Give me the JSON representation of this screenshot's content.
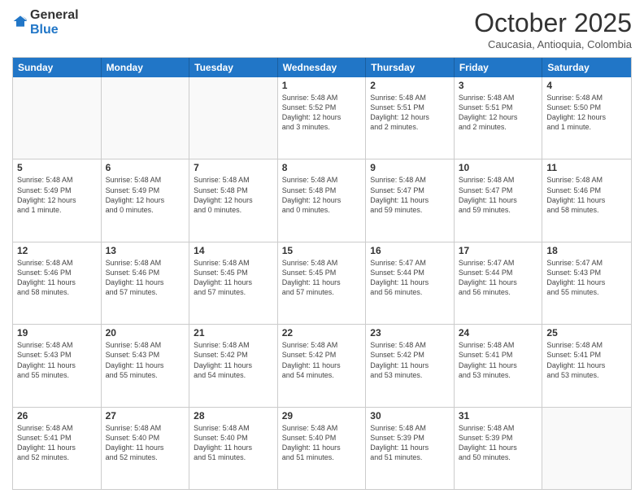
{
  "header": {
    "logo_general": "General",
    "logo_blue": "Blue",
    "month_title": "October 2025",
    "location": "Caucasia, Antioquia, Colombia"
  },
  "day_headers": [
    "Sunday",
    "Monday",
    "Tuesday",
    "Wednesday",
    "Thursday",
    "Friday",
    "Saturday"
  ],
  "rows": [
    [
      {
        "date": "",
        "info": ""
      },
      {
        "date": "",
        "info": ""
      },
      {
        "date": "",
        "info": ""
      },
      {
        "date": "1",
        "info": "Sunrise: 5:48 AM\nSunset: 5:52 PM\nDaylight: 12 hours\nand 3 minutes."
      },
      {
        "date": "2",
        "info": "Sunrise: 5:48 AM\nSunset: 5:51 PM\nDaylight: 12 hours\nand 2 minutes."
      },
      {
        "date": "3",
        "info": "Sunrise: 5:48 AM\nSunset: 5:51 PM\nDaylight: 12 hours\nand 2 minutes."
      },
      {
        "date": "4",
        "info": "Sunrise: 5:48 AM\nSunset: 5:50 PM\nDaylight: 12 hours\nand 1 minute."
      }
    ],
    [
      {
        "date": "5",
        "info": "Sunrise: 5:48 AM\nSunset: 5:49 PM\nDaylight: 12 hours\nand 1 minute."
      },
      {
        "date": "6",
        "info": "Sunrise: 5:48 AM\nSunset: 5:49 PM\nDaylight: 12 hours\nand 0 minutes."
      },
      {
        "date": "7",
        "info": "Sunrise: 5:48 AM\nSunset: 5:48 PM\nDaylight: 12 hours\nand 0 minutes."
      },
      {
        "date": "8",
        "info": "Sunrise: 5:48 AM\nSunset: 5:48 PM\nDaylight: 12 hours\nand 0 minutes."
      },
      {
        "date": "9",
        "info": "Sunrise: 5:48 AM\nSunset: 5:47 PM\nDaylight: 11 hours\nand 59 minutes."
      },
      {
        "date": "10",
        "info": "Sunrise: 5:48 AM\nSunset: 5:47 PM\nDaylight: 11 hours\nand 59 minutes."
      },
      {
        "date": "11",
        "info": "Sunrise: 5:48 AM\nSunset: 5:46 PM\nDaylight: 11 hours\nand 58 minutes."
      }
    ],
    [
      {
        "date": "12",
        "info": "Sunrise: 5:48 AM\nSunset: 5:46 PM\nDaylight: 11 hours\nand 58 minutes."
      },
      {
        "date": "13",
        "info": "Sunrise: 5:48 AM\nSunset: 5:46 PM\nDaylight: 11 hours\nand 57 minutes."
      },
      {
        "date": "14",
        "info": "Sunrise: 5:48 AM\nSunset: 5:45 PM\nDaylight: 11 hours\nand 57 minutes."
      },
      {
        "date": "15",
        "info": "Sunrise: 5:48 AM\nSunset: 5:45 PM\nDaylight: 11 hours\nand 57 minutes."
      },
      {
        "date": "16",
        "info": "Sunrise: 5:47 AM\nSunset: 5:44 PM\nDaylight: 11 hours\nand 56 minutes."
      },
      {
        "date": "17",
        "info": "Sunrise: 5:47 AM\nSunset: 5:44 PM\nDaylight: 11 hours\nand 56 minutes."
      },
      {
        "date": "18",
        "info": "Sunrise: 5:47 AM\nSunset: 5:43 PM\nDaylight: 11 hours\nand 55 minutes."
      }
    ],
    [
      {
        "date": "19",
        "info": "Sunrise: 5:48 AM\nSunset: 5:43 PM\nDaylight: 11 hours\nand 55 minutes."
      },
      {
        "date": "20",
        "info": "Sunrise: 5:48 AM\nSunset: 5:43 PM\nDaylight: 11 hours\nand 55 minutes."
      },
      {
        "date": "21",
        "info": "Sunrise: 5:48 AM\nSunset: 5:42 PM\nDaylight: 11 hours\nand 54 minutes."
      },
      {
        "date": "22",
        "info": "Sunrise: 5:48 AM\nSunset: 5:42 PM\nDaylight: 11 hours\nand 54 minutes."
      },
      {
        "date": "23",
        "info": "Sunrise: 5:48 AM\nSunset: 5:42 PM\nDaylight: 11 hours\nand 53 minutes."
      },
      {
        "date": "24",
        "info": "Sunrise: 5:48 AM\nSunset: 5:41 PM\nDaylight: 11 hours\nand 53 minutes."
      },
      {
        "date": "25",
        "info": "Sunrise: 5:48 AM\nSunset: 5:41 PM\nDaylight: 11 hours\nand 53 minutes."
      }
    ],
    [
      {
        "date": "26",
        "info": "Sunrise: 5:48 AM\nSunset: 5:41 PM\nDaylight: 11 hours\nand 52 minutes."
      },
      {
        "date": "27",
        "info": "Sunrise: 5:48 AM\nSunset: 5:40 PM\nDaylight: 11 hours\nand 52 minutes."
      },
      {
        "date": "28",
        "info": "Sunrise: 5:48 AM\nSunset: 5:40 PM\nDaylight: 11 hours\nand 51 minutes."
      },
      {
        "date": "29",
        "info": "Sunrise: 5:48 AM\nSunset: 5:40 PM\nDaylight: 11 hours\nand 51 minutes."
      },
      {
        "date": "30",
        "info": "Sunrise: 5:48 AM\nSunset: 5:39 PM\nDaylight: 11 hours\nand 51 minutes."
      },
      {
        "date": "31",
        "info": "Sunrise: 5:48 AM\nSunset: 5:39 PM\nDaylight: 11 hours\nand 50 minutes."
      },
      {
        "date": "",
        "info": ""
      }
    ]
  ]
}
